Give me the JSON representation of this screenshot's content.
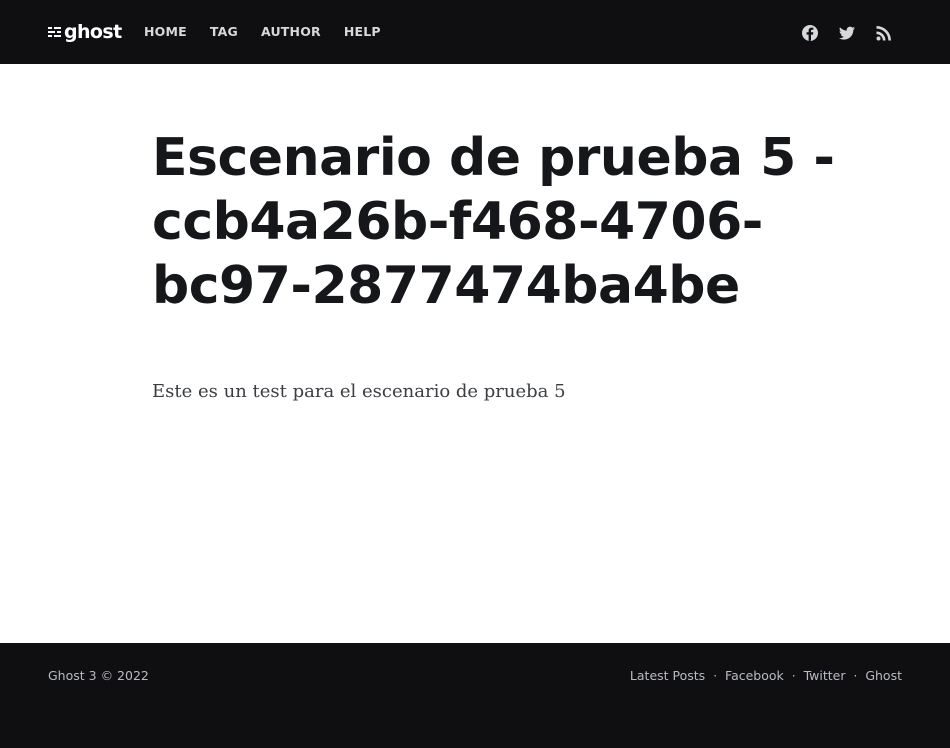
{
  "header": {
    "logo_text": "ghost",
    "nav": [
      {
        "label": "HOME"
      },
      {
        "label": "TAG"
      },
      {
        "label": "AUTHOR"
      },
      {
        "label": "HELP"
      }
    ],
    "social": [
      {
        "icon": "facebook-icon"
      },
      {
        "icon": "twitter-icon"
      },
      {
        "icon": "rss-icon"
      }
    ]
  },
  "post": {
    "title": "Escenario de prueba 5 - ccb4a26b-f468-4706-bc97-2877474ba4be",
    "content": "Este es un test para el escenario de prueba 5"
  },
  "footer": {
    "copyright": "Ghost 3 © 2022",
    "links": [
      {
        "label": "Latest Posts"
      },
      {
        "label": "Facebook"
      },
      {
        "label": "Twitter"
      },
      {
        "label": "Ghost"
      }
    ],
    "separator": "·"
  },
  "colors": {
    "header_bg": "#0f0f12",
    "footer_bg": "#0f0f12",
    "title_text": "#15171a",
    "body_text": "#3a3d42"
  }
}
